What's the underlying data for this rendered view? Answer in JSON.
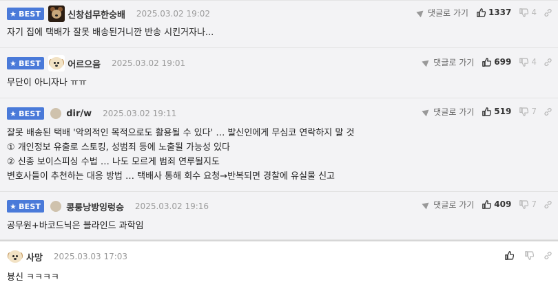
{
  "badge_label": "BEST",
  "comments": [
    {
      "nickname": "신창섭무한숭배",
      "date": "2025.03.02 19:02",
      "reply_label": "댓글로 가기",
      "upvotes": "1337",
      "downvotes": "4",
      "lines": [
        "자기 집에 택배가 잘못 배송된거니깐 반송 시킨거자나..."
      ]
    },
    {
      "nickname": "어르으음",
      "date": "2025.03.02 19:01",
      "reply_label": "댓글로 가기",
      "upvotes": "699",
      "downvotes": "4",
      "lines": [
        "무단이 아니자나 ㅠㅠ"
      ]
    },
    {
      "nickname": "dir/w",
      "date": "2025.03.02 19:11",
      "reply_label": "댓글로 가기",
      "upvotes": "519",
      "downvotes": "7",
      "lines": [
        "잘못 배송된 택배 '악의적인 목적으로도 활용될 수 있다' … 발신인에게 무심코 연락하지 말 것",
        "① 개인정보 유출로 스토킹, 성범죄 등에 노출될 가능성 있다",
        "② 신종 보이스피싱 수법 … 나도 모르게 범죄 연루될지도",
        "변호사들이 추천하는 대응 방법 … 택배사 통해 회수 요청→반복되면 경찰에 유실물 신고"
      ]
    },
    {
      "nickname": "콩룽낭방잉렁승",
      "date": "2025.03.02 19:16",
      "reply_label": "댓글로 가기",
      "upvotes": "409",
      "downvotes": "7",
      "lines": [
        "공무원+바코드닉은 블라인드 과학임"
      ]
    },
    {
      "nickname": "사망",
      "date": "2025.03.03 17:03",
      "lines": [
        "븅신 ㅋㅋㅋㅋ"
      ]
    }
  ],
  "colors": {
    "best_badge": "#4a7ad9",
    "best_background": "#f3f3f5",
    "date_text": "#9a9a9a"
  },
  "icons": [
    "star-icon",
    "send-icon",
    "thumbs-up-icon",
    "thumbs-down-icon",
    "link-icon"
  ]
}
